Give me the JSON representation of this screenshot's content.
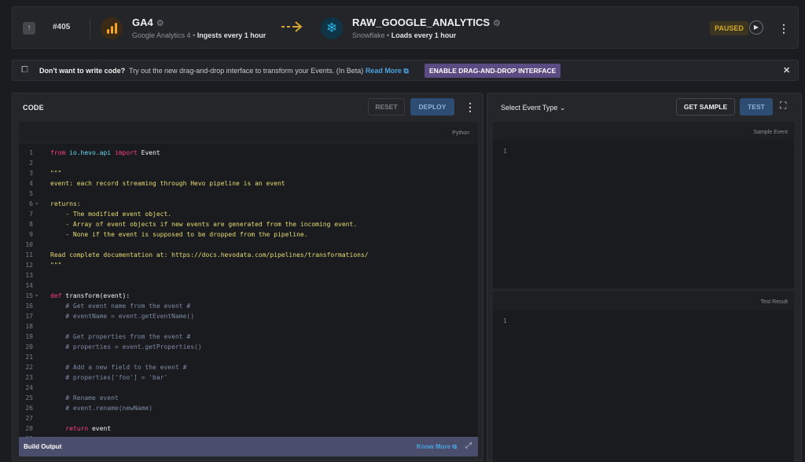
{
  "header": {
    "pipeline_id": "#405",
    "source": {
      "title": "GA4",
      "subtitle": "Google Analytics 4",
      "schedule": "Ingests every 1 hour"
    },
    "destination": {
      "title": "RAW_GOOGLE_ANALYTICS",
      "subtitle": "Snowflake",
      "schedule": "Loads every 1 hour"
    },
    "status": "PAUSED",
    "separator": "•",
    "up_icon": "↑",
    "gear_icon": "⚙",
    "play_icon": "▶",
    "snowflake_icon": "❄",
    "kebab_icon": "⋮"
  },
  "banner": {
    "question": "Don't want to write code?",
    "text": "Try out the new drag-and-drop interface to transform your Events. (In Beta)",
    "link": "Read More",
    "external_icon": "⧉",
    "button": "ENABLE DRAG-AND-DROP INTERFACE",
    "close_icon": "✕",
    "info_icon": "⧠"
  },
  "code_panel": {
    "title": "CODE",
    "reset": "RESET",
    "deploy": "DEPLOY",
    "language": "Python",
    "build_output": "Build Output",
    "know_more": "Know More",
    "expand_icon": "⤢"
  },
  "right_panel": {
    "event_type": "Select Event Type",
    "chevron": "⌄",
    "get_sample": "GET SAMPLE",
    "test": "TEST",
    "fullscreen_icon": "⛶",
    "sample_event_label": "Sample Event",
    "sample_event_line": "1",
    "test_result_label": "Test Result",
    "test_result_line": "1"
  },
  "code": [
    {
      "n": "1",
      "t": "from io.hevo.api import Event",
      "k": "import"
    },
    {
      "n": "2",
      "t": "",
      "k": "plain"
    },
    {
      "n": "3",
      "t": "\"\"\"",
      "k": "str"
    },
    {
      "n": "4",
      "t": "event: each record streaming through Hevo pipeline is an event",
      "k": "str"
    },
    {
      "n": "5",
      "t": "",
      "k": "plain"
    },
    {
      "n": "6",
      "t": "returns:",
      "k": "str",
      "fold": true
    },
    {
      "n": "7",
      "t": "    - The modified event object.",
      "k": "str"
    },
    {
      "n": "8",
      "t": "    - Array of event objects if new events are generated from the incoming event.",
      "k": "str"
    },
    {
      "n": "9",
      "t": "    - None if the event is supposed to be dropped from the pipeline.",
      "k": "str"
    },
    {
      "n": "10",
      "t": "",
      "k": "plain"
    },
    {
      "n": "11",
      "t": "Read complete documentation at: https://docs.hevodata.com/pipelines/transformations/",
      "k": "str"
    },
    {
      "n": "12",
      "t": "\"\"\"",
      "k": "str"
    },
    {
      "n": "13",
      "t": "",
      "k": "plain"
    },
    {
      "n": "14",
      "t": "",
      "k": "plain"
    },
    {
      "n": "15",
      "t": "def transform(event):",
      "k": "def",
      "fold": true
    },
    {
      "n": "16",
      "t": "    # Get event name from the event #",
      "k": "cm"
    },
    {
      "n": "17",
      "t": "    # eventName = event.getEventName()",
      "k": "cm"
    },
    {
      "n": "18",
      "t": "",
      "k": "plain"
    },
    {
      "n": "19",
      "t": "    # Get properties from the event #",
      "k": "cm"
    },
    {
      "n": "20",
      "t": "    # properties = event.getProperties()",
      "k": "cm"
    },
    {
      "n": "21",
      "t": "",
      "k": "plain"
    },
    {
      "n": "22",
      "t": "    # Add a new field to the event #",
      "k": "cm"
    },
    {
      "n": "23",
      "t": "    # properties['foo'] = 'bar'",
      "k": "cm"
    },
    {
      "n": "24",
      "t": "",
      "k": "plain"
    },
    {
      "n": "25",
      "t": "    # Rename event",
      "k": "cm"
    },
    {
      "n": "26",
      "t": "    # event.rename(newName)",
      "k": "cm"
    },
    {
      "n": "27",
      "t": "",
      "k": "plain"
    },
    {
      "n": "28",
      "t": "    return event",
      "k": "ret"
    },
    {
      "n": "29",
      "t": "",
      "k": "plain"
    }
  ]
}
